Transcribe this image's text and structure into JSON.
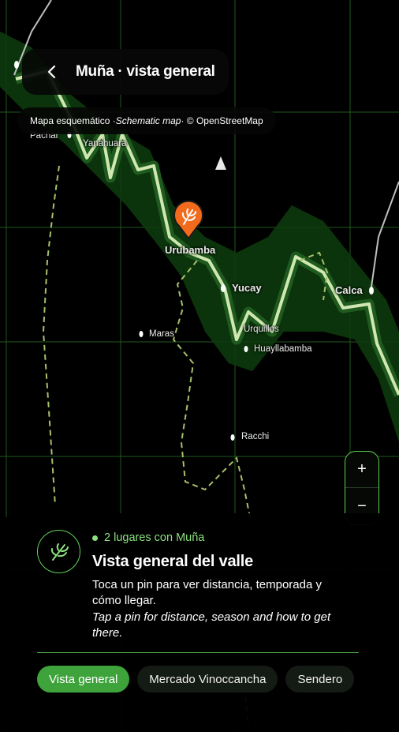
{
  "header": {
    "title": "Muña · vista general"
  },
  "attribution": {
    "es": "Mapa esquemático · ",
    "en": "Schematic map",
    "credit": " · © OpenStreetMap"
  },
  "map": {
    "places": [
      {
        "name": "Pachar",
        "bold": false
      },
      {
        "name": "Yanahuara",
        "bold": false
      },
      {
        "name": "Urubamba",
        "bold": true
      },
      {
        "name": "Yucay",
        "bold": true
      },
      {
        "name": "Calca",
        "bold": true
      },
      {
        "name": "Maras",
        "bold": false
      },
      {
        "name": "Urquillos",
        "bold": false
      },
      {
        "name": "Huayllabamba",
        "bold": false
      },
      {
        "name": "Racchi",
        "bold": false
      }
    ]
  },
  "zoom": {
    "in": "+",
    "out": "−"
  },
  "sheet": {
    "meta": "2 lugares con Muña",
    "title": "Vista general del valle",
    "desc": "Toca un pin para ver distancia, temporada y cómo llegar.",
    "desc_en": "Tap a pin for distance, season and how to get there.",
    "chips": [
      "Vista general",
      "Mercado Vinoccancha",
      "Sendero"
    ]
  },
  "colors": {
    "accent": "#5fd157",
    "pin": "#f26b1d",
    "river": "#cfe7b0"
  },
  "icons": [
    "back-arrow-icon",
    "leaf-icon",
    "north-arrow-icon",
    "plus-icon",
    "minus-icon"
  ]
}
